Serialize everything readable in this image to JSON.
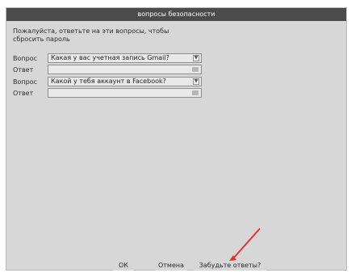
{
  "dialog": {
    "title": "вопросы безопасности",
    "instructions": "Пожалуйста, ответьте на эти вопросы, чтобы сбросить пароль",
    "rows": [
      {
        "label": "Вопрос",
        "type": "select",
        "value": "Какая у вас учетная запись Gmail?"
      },
      {
        "label": "Ответ",
        "type": "input",
        "value": ""
      },
      {
        "label": "Вопрос",
        "type": "select",
        "value": "Какой у тебя аккаунт в Facebook?"
      },
      {
        "label": "Ответ",
        "type": "input",
        "value": ""
      }
    ],
    "buttons": {
      "ok": "ОК",
      "cancel": "Отмена",
      "forgot": "Забудьте ответы?"
    },
    "annotation_color": "#e53030"
  }
}
